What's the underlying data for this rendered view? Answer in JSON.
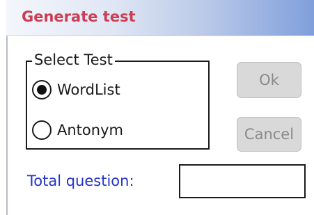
{
  "dialog": {
    "title": "Generate test"
  },
  "select_test": {
    "legend": "Select Test",
    "options": [
      {
        "label": "WordList",
        "selected": true
      },
      {
        "label": "Antonym",
        "selected": false
      }
    ]
  },
  "buttons": {
    "ok_label": "Ok",
    "cancel_label": "Cancel"
  },
  "total_question": {
    "label": "Total question:",
    "value": ""
  },
  "colors": {
    "title_text": "#cc3d55",
    "label_blue": "#2233cc",
    "button_bg": "#d9d9d9",
    "button_text": "#8a8a8a"
  }
}
